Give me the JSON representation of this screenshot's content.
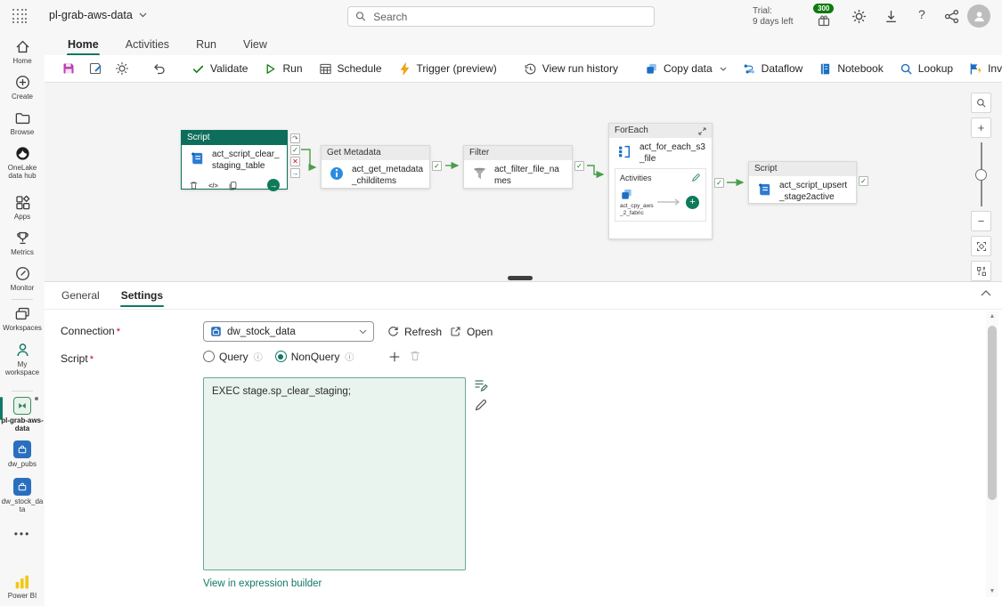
{
  "colors": {
    "accent": "#117865",
    "selected_node_header": "#0e6e5c",
    "connector_green": "#4a9e4a",
    "save_icon_magenta": "#bc3fb0",
    "toolbar_icon_blue": "#1b6fc1",
    "trigger_yellow": "#f8a800",
    "canvas_bg": "#f4f4f4",
    "script_box_bg": "#e9f4ee"
  },
  "header": {
    "title": "pl-grab-aws-data",
    "search_placeholder": "Search",
    "trial_line1": "Trial:",
    "trial_line2": "9 days left",
    "badge_count": "300",
    "help": "?"
  },
  "ribbon": {
    "tabs": [
      {
        "label": "Home",
        "active": true
      },
      {
        "label": "Activities",
        "active": false
      },
      {
        "label": "Run",
        "active": false
      },
      {
        "label": "View",
        "active": false
      }
    ]
  },
  "toolbar": {
    "validate": "Validate",
    "run": "Run",
    "schedule": "Schedule",
    "trigger": "Trigger (preview)",
    "history": "View run history",
    "copy_data": "Copy data",
    "dataflow": "Dataflow",
    "notebook": "Notebook",
    "lookup": "Lookup",
    "invoke": "Invoke Pipeline"
  },
  "sidebar": {
    "items": [
      {
        "label": "Home"
      },
      {
        "label": "Create"
      },
      {
        "label": "Browse"
      },
      {
        "label": "OneLake data hub"
      },
      {
        "label": "Apps"
      },
      {
        "label": "Metrics"
      },
      {
        "label": "Monitor"
      },
      {
        "label": "Workspaces"
      },
      {
        "label": "My workspace"
      },
      {
        "label": "pl-grab-aws-data",
        "selected": true
      },
      {
        "label": "dw_pubs"
      },
      {
        "label": "dw_stock_data"
      },
      {
        "label": "Power BI"
      }
    ],
    "more": "•••"
  },
  "canvas": {
    "nodes": {
      "script1": {
        "type": "Script",
        "name": "act_script_clear_staging_table",
        "selected": true
      },
      "get_metadata": {
        "type": "Get Metadata",
        "name": "act_get_metadata_childitems"
      },
      "filter": {
        "type": "Filter",
        "name": "act_filter_file_names"
      },
      "foreach": {
        "type": "ForEach",
        "name": "act_for_each_s3_file",
        "activities_label": "Activities",
        "child_name": "act_cpy_aws_2_fabric"
      },
      "script2": {
        "type": "Script",
        "name": "act_script_upsert_stage2active"
      }
    },
    "code_glyph": "</>"
  },
  "panel": {
    "tab_general": "General",
    "tab_settings": "Settings",
    "required_mark": "*",
    "connection_label": "Connection",
    "connection_value": "dw_stock_data",
    "refresh_label": "Refresh",
    "open_label": "Open",
    "script_label": "Script",
    "radio_query": "Query",
    "radio_nonquery": "NonQuery",
    "script_text": "EXEC stage.sp_clear_staging;",
    "expression_link": "View in expression builder"
  }
}
